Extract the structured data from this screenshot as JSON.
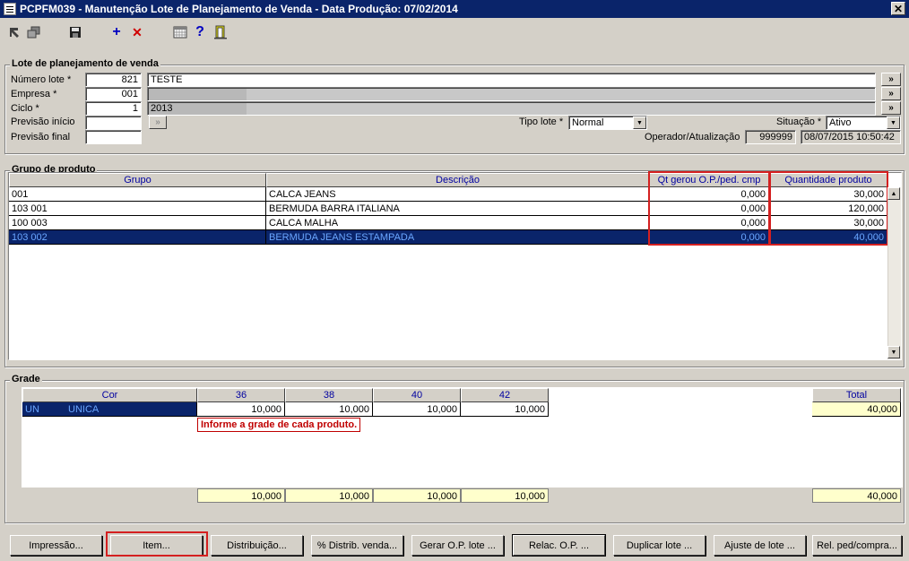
{
  "window": {
    "title": "PCPFM039 - Manutenção Lote de Planejamento de Venda - Data Produção: 07/02/2014",
    "close_label": "✕"
  },
  "toolbar": {
    "icons": [
      "nav-back-icon",
      "nav-copy-icon",
      "save-icon",
      "add-icon",
      "delete-icon",
      "calendar-icon",
      "help-icon",
      "exit-door-icon"
    ],
    "add_label": "+",
    "delete_label": "✕",
    "help_label": "?"
  },
  "lote": {
    "group_title": "Lote de planejamento de venda",
    "numero_label": "Número lote *",
    "numero_value": "821",
    "nome_value": "TESTE",
    "empresa_label": "Empresa *",
    "empresa_value": "001",
    "ciclo_label": "Ciclo *",
    "ciclo_value": "1",
    "ciclo_desc": "2013",
    "prev_inicio_label": "Previsão início",
    "prev_inicio_value": "",
    "prev_final_label": "Previsão final",
    "prev_final_value": "",
    "tipo_label": "Tipo lote *",
    "tipo_value": "Normal",
    "situacao_label": "Situação *",
    "situacao_value": "Ativo",
    "operador_label": "Operador/Atualização",
    "operador_value": "999999",
    "atualizacao_value": "08/07/2015 10:50:42",
    "lookup_label": "»"
  },
  "grupo": {
    "group_title": "Grupo de produto",
    "columns": [
      "Grupo",
      "Descrição",
      "Qt gerou O.P./ped. cmp",
      "Quantidade produto"
    ],
    "rows": [
      {
        "grupo": "001",
        "descricao": "CALCA JEANS",
        "qt_gerou": "0,000",
        "quantidade": "30,000"
      },
      {
        "grupo": "103 001",
        "descricao": "BERMUDA BARRA ITALIANA",
        "qt_gerou": "0,000",
        "quantidade": "120,000"
      },
      {
        "grupo": "100 003",
        "descricao": "CALCA MALHA",
        "qt_gerou": "0,000",
        "quantidade": "30,000"
      },
      {
        "grupo": "103 002",
        "descricao": "BERMUDA JEANS ESTAMPADA",
        "qt_gerou": "0,000",
        "quantidade": "40,000"
      }
    ]
  },
  "grade": {
    "group_title": "Grade",
    "columns": [
      "Cor",
      "36",
      "38",
      "40",
      "42"
    ],
    "total_label": "Total",
    "row": {
      "code": "UN",
      "name": "UNICA",
      "values": [
        "10,000",
        "10,000",
        "10,000",
        "10,000"
      ],
      "total": "40,000"
    },
    "totals": [
      "10,000",
      "10,000",
      "10,000",
      "10,000"
    ],
    "grand_total": "40,000",
    "tooltip": "Informe a grade de cada produto."
  },
  "buttons": [
    "Impressão...",
    "Item...",
    "Distribuição...",
    "% Distrib. venda...",
    "Gerar O.P. lote ...",
    "Relac. O.P. ...",
    "Duplicar lote ...",
    "Ajuste de lote ...",
    "Rel. ped/compra..."
  ],
  "colors": {
    "titlebar": "#0a246a",
    "selection": "#0a246a",
    "highlight_box": "#d42020",
    "total_fill": "#ffffcc"
  }
}
